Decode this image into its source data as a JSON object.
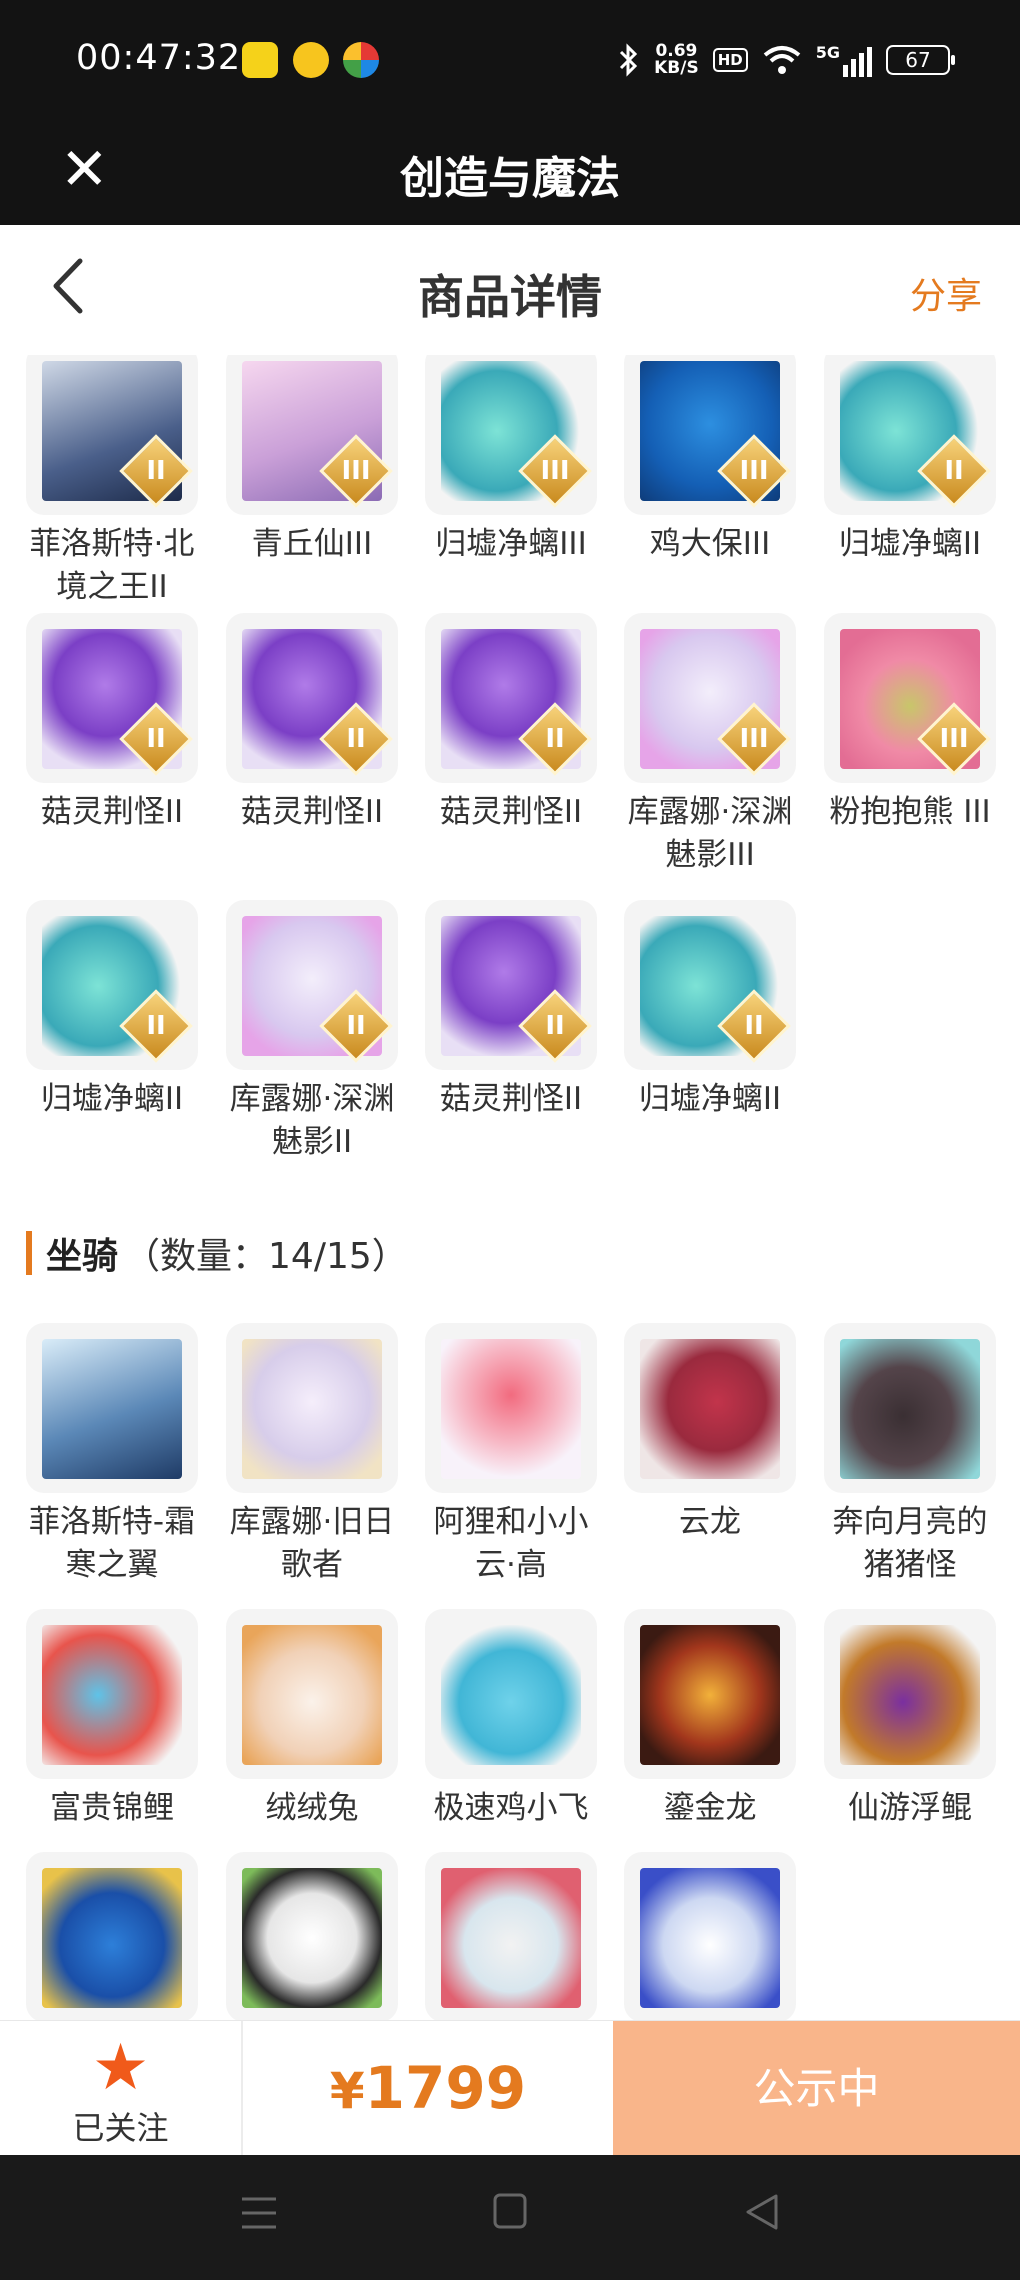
{
  "status_bar": {
    "time": "00:47:32",
    "net_speed": "0.69",
    "net_unit": "KB/S",
    "hd": "HD",
    "signal": "5G",
    "battery": "67"
  },
  "app_bar": {
    "title": "创造与魔法"
  },
  "header": {
    "title": "商品详情",
    "share": "分享"
  },
  "badges": {
    "II": "II",
    "III": "III"
  },
  "pets": [
    {
      "label": "菲洛斯特·北境之王II",
      "badge": "II"
    },
    {
      "label": "青丘仙III",
      "badge": "III"
    },
    {
      "label": "归墟净螭III",
      "badge": "III"
    },
    {
      "label": "鸡大保III",
      "badge": "III"
    },
    {
      "label": "归墟净螭II",
      "badge": "II"
    },
    {
      "label": "菇灵荆怪II",
      "badge": "II"
    },
    {
      "label": "菇灵荆怪II",
      "badge": "II"
    },
    {
      "label": "菇灵荆怪II",
      "badge": "II"
    },
    {
      "label": "库露娜·深渊魅影III",
      "badge": "III"
    },
    {
      "label": "粉抱抱熊 III",
      "badge": "III"
    },
    {
      "label": "归墟净螭II",
      "badge": "II"
    },
    {
      "label": "库露娜·深渊魅影II",
      "badge": "II"
    },
    {
      "label": "菇灵荆怪II",
      "badge": "II"
    },
    {
      "label": "归墟净螭II",
      "badge": "II"
    }
  ],
  "mounts_section": {
    "title": "坐骑",
    "count": "（数量：14/15）"
  },
  "mounts": [
    {
      "label": "菲洛斯特-霜寒之翼"
    },
    {
      "label": "库露娜·旧日歌者"
    },
    {
      "label": "阿狸和小小云·高"
    },
    {
      "label": "云龙"
    },
    {
      "label": "奔向月亮的猪猪怪"
    },
    {
      "label": "富贵锦鲤"
    },
    {
      "label": "绒绒兔"
    },
    {
      "label": "极速鸡小飞"
    },
    {
      "label": "鎏金龙"
    },
    {
      "label": "仙游浮鲲"
    }
  ],
  "bottom_bar": {
    "follow_label": "已关注",
    "currency": "¥",
    "price": "1799",
    "status": "公示中"
  },
  "colors": {
    "accent": "#e47a1f",
    "status_button": "#f9b58a",
    "dark": "#131313"
  }
}
